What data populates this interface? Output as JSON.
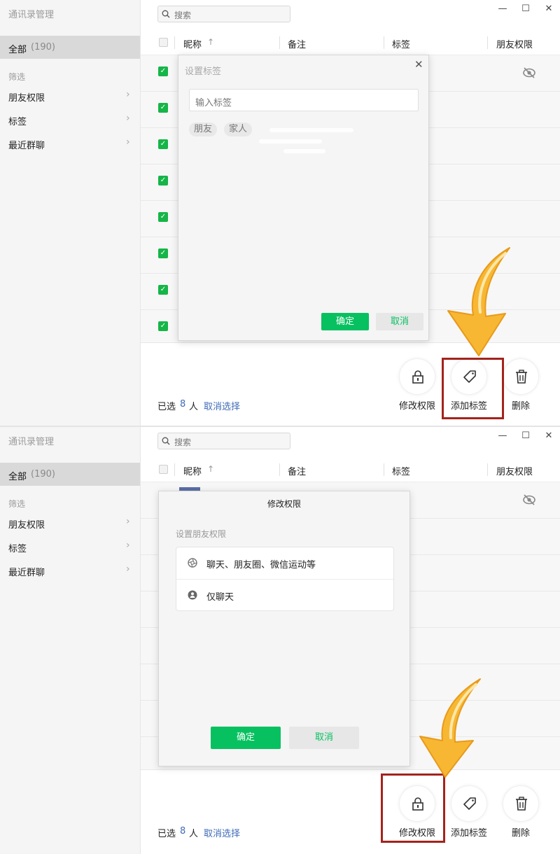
{
  "app": {
    "title": "通讯录管理"
  },
  "sidebar": {
    "all_label": "全部",
    "all_count": "(190)",
    "filter_label": "筛选",
    "items": [
      {
        "label": "朋友权限"
      },
      {
        "label": "标签"
      },
      {
        "label": "最近群聊"
      }
    ]
  },
  "search": {
    "placeholder": "搜索"
  },
  "window": {
    "minimize": "—",
    "maximize": "☐",
    "close": "✕"
  },
  "table": {
    "columns": [
      "昵称",
      "备注",
      "标签",
      "朋友权限"
    ],
    "sort_indicator": "↑"
  },
  "footer": {
    "selected_label": "已选",
    "selected_count": "8",
    "selected_unit": "人",
    "cancel_selection": "取消选择",
    "actions": [
      {
        "label": "修改权限",
        "icon": "lock-icon"
      },
      {
        "label": "添加标签",
        "icon": "tag-icon"
      },
      {
        "label": "删除",
        "icon": "trash-icon"
      }
    ]
  },
  "tag_dialog": {
    "title": "设置标签",
    "input_placeholder": "输入标签",
    "chips": [
      "朋友",
      "家人"
    ],
    "confirm": "确定",
    "cancel": "取消"
  },
  "perm_dialog": {
    "title": "修改权限",
    "subtitle": "设置朋友权限",
    "options": [
      {
        "label": "聊天、朋友圈、微信运动等",
        "icon": "shutter-icon"
      },
      {
        "label": "仅聊天",
        "icon": "person-icon"
      }
    ],
    "confirm": "确定",
    "cancel": "取消"
  },
  "colors": {
    "accent_green": "#07c160",
    "checkbox_green": "#16b548",
    "highlight_red": "#a3231d",
    "arrow_yellow": "#f7b733",
    "link_blue": "#3f6bb8"
  }
}
